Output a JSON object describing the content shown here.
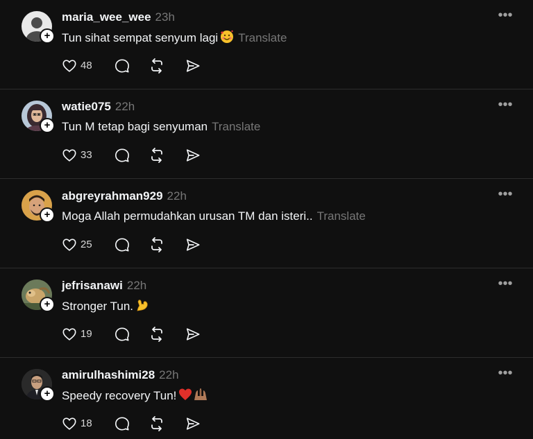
{
  "feed": {
    "posts": [
      {
        "username": "maria_wee_wee",
        "time": "23h",
        "text": "Tun sihat sempat senyum lagi",
        "emoji": "smiling-face-with-hearts",
        "translate": "Translate",
        "likes": "48",
        "avatar": "default"
      },
      {
        "username": "watie075",
        "time": "22h",
        "text": "Tun M tetap bagi senyuman",
        "emoji": "",
        "translate": "Translate",
        "likes": "33",
        "avatar": "woman-hijab"
      },
      {
        "username": "abgreyrahman929",
        "time": "22h",
        "text": "Moga Allah permudahkan urusan TM dan isteri..",
        "emoji": "",
        "translate": "Translate",
        "likes": "25",
        "avatar": "man-portrait"
      },
      {
        "username": "jefrisanawi",
        "time": "22h",
        "text": "Stronger Tun.",
        "emoji": "flexed-biceps",
        "translate": "",
        "likes": "19",
        "avatar": "animal-photo"
      },
      {
        "username": "amirulhashimi28",
        "time": "22h",
        "text": "Speedy recovery Tun!",
        "emoji": "red-heart-folded-hands",
        "translate": "",
        "likes": "18",
        "avatar": "man-dark"
      }
    ]
  },
  "colors": {
    "background": "#101010",
    "text": "#f3f5f7",
    "muted": "#777777",
    "divider": "#2d2d2d"
  }
}
